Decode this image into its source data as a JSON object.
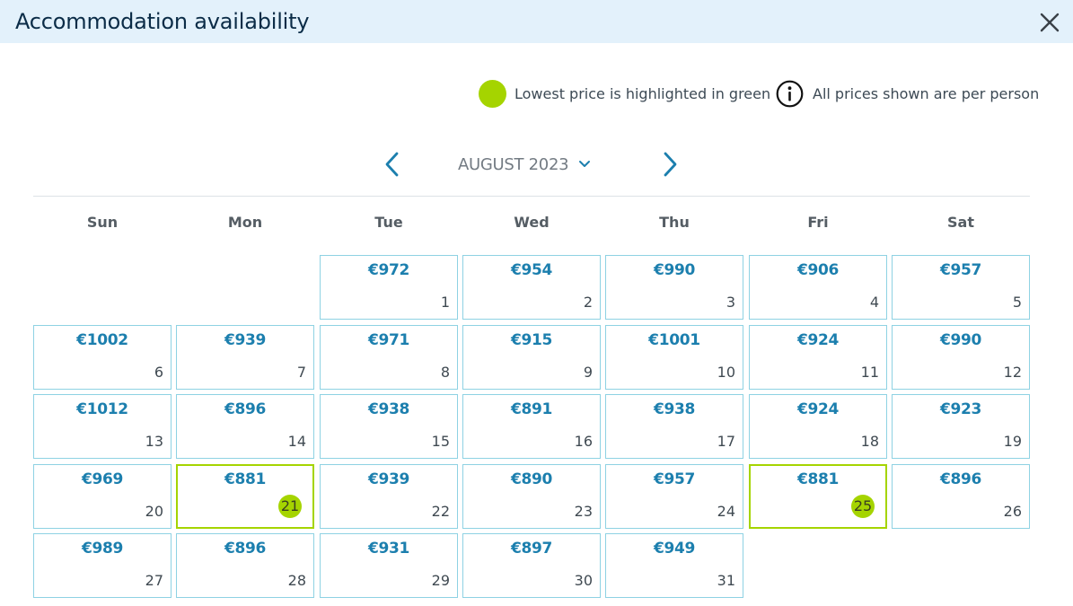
{
  "header": {
    "title": "Accommodation availability"
  },
  "legend": {
    "lowest_label": "Lowest price is highlighted in green",
    "per_person_label": "All prices shown are per person"
  },
  "calendar": {
    "month_label": "AUGUST 2023",
    "weekdays": [
      "Sun",
      "Mon",
      "Tue",
      "Wed",
      "Thu",
      "Fri",
      "Sat"
    ],
    "first_weekday_index": 2,
    "days": [
      {
        "day": "1",
        "price": "€972"
      },
      {
        "day": "2",
        "price": "€954"
      },
      {
        "day": "3",
        "price": "€990"
      },
      {
        "day": "4",
        "price": "€906"
      },
      {
        "day": "5",
        "price": "€957"
      },
      {
        "day": "6",
        "price": "€1002"
      },
      {
        "day": "7",
        "price": "€939"
      },
      {
        "day": "8",
        "price": "€971"
      },
      {
        "day": "9",
        "price": "€915"
      },
      {
        "day": "10",
        "price": "€1001"
      },
      {
        "day": "11",
        "price": "€924"
      },
      {
        "day": "12",
        "price": "€990"
      },
      {
        "day": "13",
        "price": "€1012"
      },
      {
        "day": "14",
        "price": "€896"
      },
      {
        "day": "15",
        "price": "€938"
      },
      {
        "day": "16",
        "price": "€891"
      },
      {
        "day": "17",
        "price": "€938"
      },
      {
        "day": "18",
        "price": "€924"
      },
      {
        "day": "19",
        "price": "€923"
      },
      {
        "day": "20",
        "price": "€969"
      },
      {
        "day": "21",
        "price": "€881",
        "lowest": true
      },
      {
        "day": "22",
        "price": "€939"
      },
      {
        "day": "23",
        "price": "€890"
      },
      {
        "day": "24",
        "price": "€957"
      },
      {
        "day": "25",
        "price": "€881",
        "lowest": true
      },
      {
        "day": "26",
        "price": "€896"
      },
      {
        "day": "27",
        "price": "€989"
      },
      {
        "day": "28",
        "price": "€896"
      },
      {
        "day": "29",
        "price": "€931"
      },
      {
        "day": "30",
        "price": "€897"
      },
      {
        "day": "31",
        "price": "€949"
      }
    ]
  },
  "icons": {
    "close": "close-icon",
    "info": "info-icon",
    "prev": "chevron-left-icon",
    "next": "chevron-right-icon",
    "dropdown": "chevron-down-icon"
  },
  "colors": {
    "header_bg": "#e3f1fb",
    "price": "#1c7fae",
    "cell_border": "#8ed2e3",
    "lowest_highlight": "#a5d400",
    "nav_arrow": "#1c7fae"
  }
}
